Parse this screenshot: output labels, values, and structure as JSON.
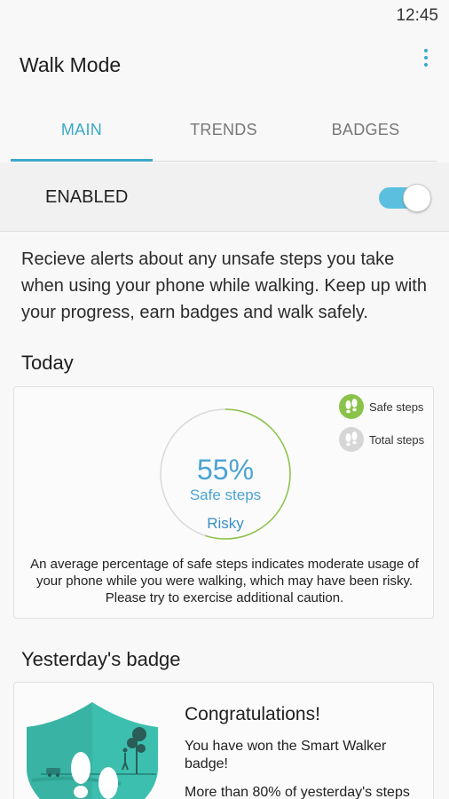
{
  "status_bar": {
    "time": "12:45"
  },
  "app_bar": {
    "title": "Walk Mode"
  },
  "tabs": [
    {
      "label": "MAIN",
      "active": true
    },
    {
      "label": "TRENDS",
      "active": false
    },
    {
      "label": "BADGES",
      "active": false
    }
  ],
  "enabled": {
    "label": "ENABLED",
    "on": true
  },
  "description": "Recieve alerts about any unsafe steps you take when using your phone while walking. Keep up with your progress, earn badges and walk safely.",
  "today": {
    "title": "Today",
    "safe_percent_text": "55%",
    "safe_percent_value": 55,
    "safe_label": "Safe steps",
    "risk_label": "Risky",
    "legend": [
      {
        "label": "Safe steps",
        "color": "#8bc34a",
        "icon": "footsteps-icon"
      },
      {
        "label": "Total steps",
        "color": "#d6d6d6",
        "icon": "footsteps-icon"
      }
    ],
    "note": "An average percentage of safe steps indicates moderate usage of your phone while you were walking, which may have been risky. Please try to exercise additional caution."
  },
  "yesterday": {
    "title": "Yesterday's badge",
    "badge_title": "Congratulations!",
    "badge_line1": "You have won the Smart Walker badge!",
    "badge_line2": "More than 80% of yesterday's steps"
  },
  "colors": {
    "accent": "#3aa9c9",
    "toggle_track": "#5bc0e0",
    "ring_safe": "#8bc34a",
    "badge_teal": "#3cbfae"
  }
}
